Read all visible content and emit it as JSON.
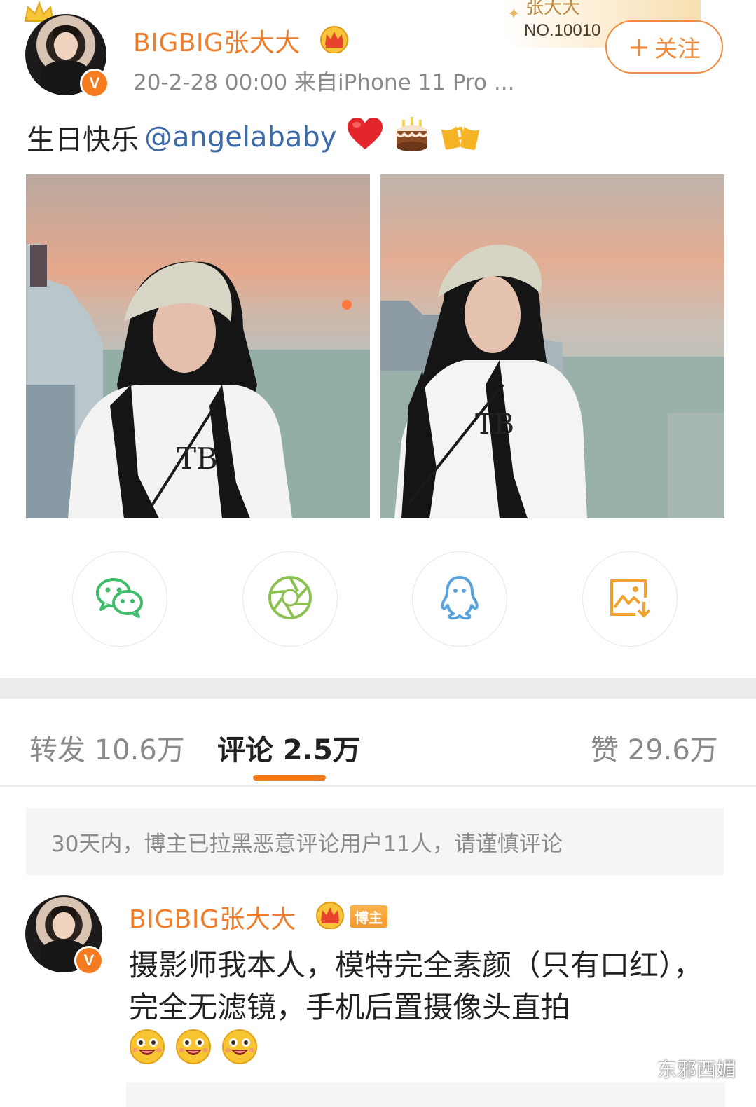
{
  "post": {
    "username": "BIGBIG张大大",
    "verified_badge": "V",
    "meta": "20-2-28 00:00  来自iPhone 11 Pro ...",
    "fan_card": {
      "name": "张大大",
      "number": "NO.10010"
    },
    "follow_label": "关注",
    "follow_prefix": "+",
    "text": "生日快乐",
    "mention": "@angelababy",
    "emojis": [
      "heart-emoji",
      "cake-emoji",
      "cheers-emoji"
    ]
  },
  "share": {
    "items": [
      "wechat-icon",
      "moments-icon",
      "qq-icon",
      "save-image-icon"
    ]
  },
  "stats": {
    "repost": "转发 10.6万",
    "comment": "评论 2.5万",
    "like": "赞 29.6万",
    "active_tab": "comment"
  },
  "notice": "30天内，博主已拉黑恶意评论用户11人，请谨慎评论",
  "comment": {
    "username": "BIGBIG张大大",
    "author_tag": "博主",
    "verified_badge": "V",
    "text": "摄影师我本人，模特完全素颜（只有口红），完全无滤镜，手机后置摄像头直拍",
    "emojis": [
      "grin-face-emoji",
      "grin-face-emoji",
      "grin-face-emoji"
    ]
  },
  "watermark": "东邪西媚",
  "colors": {
    "accent_orange": "#ef7d2a",
    "mention_blue": "#3d6aa8",
    "tab_indicator": "#f07a1c",
    "wechat_green": "#3fbd6b",
    "moments_green": "#8cc152",
    "qq_blue": "#5aa2dc",
    "save_orange": "#f0a12e"
  }
}
